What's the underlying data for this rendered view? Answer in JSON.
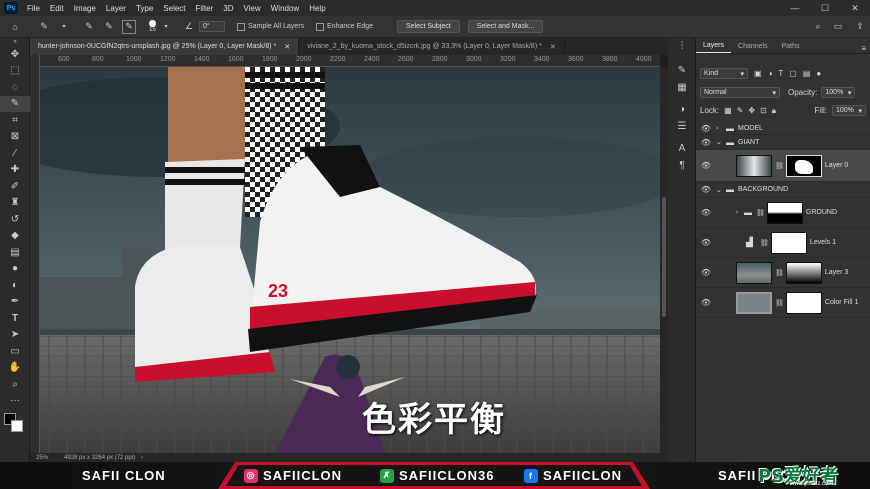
{
  "app": {
    "logo": "Ps"
  },
  "menu": [
    "File",
    "Edit",
    "Image",
    "Layer",
    "Type",
    "Select",
    "Filter",
    "3D",
    "View",
    "Window",
    "Help"
  ],
  "window_controls": {
    "minimize": "—",
    "maximize": "☐",
    "close": "✕"
  },
  "options_bar": {
    "brush_size": "15",
    "angle": "0°",
    "sample_all_layers": "Sample All Layers",
    "enhance_edge": "Enhance Edge",
    "select_subject": "Select Subject",
    "select_and_mask": "Select and Mask..."
  },
  "doc_tabs": [
    {
      "label": "hunter-johnson-0UCGfN2qtrs-unsplash.jpg @ 25% (Layer 0, Layer Mask/8) *"
    },
    {
      "label": "viviane_2_by_kuoma_stock_d5izcrk.jpg @ 33,3% (Layer 0, Layer Mask/8) *"
    }
  ],
  "ruler_top": [
    "600",
    "800",
    "1000",
    "1200",
    "1400",
    "1600",
    "1800",
    "2000",
    "2200",
    "2400",
    "2600",
    "2800",
    "3000",
    "3200",
    "3400",
    "3600",
    "3800",
    "4000"
  ],
  "canvas": {
    "caption": "色彩平衡",
    "shoe_number": "23"
  },
  "status": {
    "zoom": "25%",
    "doc_size": "4928 px x 3264 px (72 ppi)"
  },
  "panel": {
    "tabs": [
      "Layers",
      "Channels",
      "Paths"
    ],
    "filter_kind": "Kind",
    "blend_mode": "Normal",
    "opacity_label": "Opacity:",
    "opacity_value": "100%",
    "lock_label": "Lock:",
    "fill_label": "Fill:",
    "fill_value": "100%",
    "layers": [
      {
        "name": "MODEL",
        "type": "group",
        "expanded": false
      },
      {
        "name": "GIANT",
        "type": "group",
        "expanded": true
      },
      {
        "name": "Layer 0",
        "type": "layer",
        "selected": true
      },
      {
        "name": "BACKGROUND",
        "type": "group",
        "expanded": true
      },
      {
        "name": "GROUND",
        "type": "group",
        "expanded": false
      },
      {
        "name": "Levels 1",
        "type": "adjustment"
      },
      {
        "name": "Layer 3",
        "type": "layer"
      },
      {
        "name": "Color Fill 1",
        "type": "fill"
      }
    ]
  },
  "footer": {
    "left_name": "SAFII CLON",
    "instagram": "SAFIICLON",
    "other": "SAFIICLON36",
    "facebook": "SAFIICLON",
    "right_name": "SAFII CLON",
    "watermark": "PS爱好者",
    "watermark_url": "www.psahz.com"
  },
  "colors": {
    "accent": "#c8102e",
    "ps_blue": "#31a8ff",
    "instagram": "#e1306c",
    "facebook": "#1877f2",
    "green": "#25a244"
  }
}
